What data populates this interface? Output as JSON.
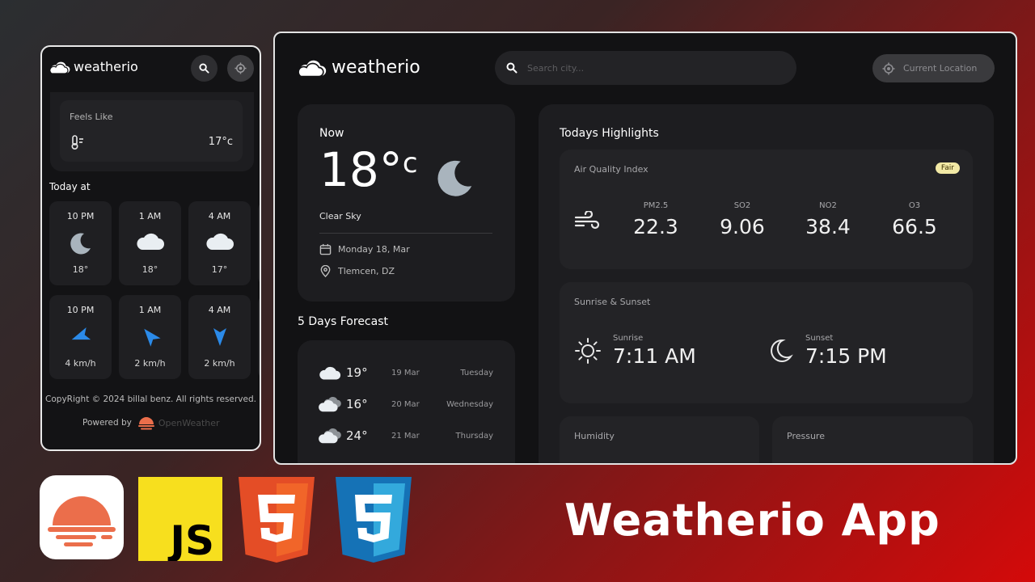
{
  "mobile": {
    "logo_text": "weatherio",
    "feels_like": {
      "label": "Feels Like",
      "value": "17°c"
    },
    "today_label": "Today at",
    "hourly_temp": [
      {
        "time": "10 PM",
        "icon": "moon-icon",
        "value": "18°"
      },
      {
        "time": "1 AM",
        "icon": "cloud-icon",
        "value": "18°"
      },
      {
        "time": "4 AM",
        "icon": "cloud-icon",
        "value": "17°"
      }
    ],
    "hourly_wind": [
      {
        "time": "10 PM",
        "icon": "wind-direction-icon",
        "value": "4 km/h"
      },
      {
        "time": "1 AM",
        "icon": "wind-direction-icon",
        "value": "2 km/h"
      },
      {
        "time": "4 AM",
        "icon": "wind-direction-icon",
        "value": "2 km/h"
      }
    ],
    "copyright": "CopyRight © 2024 billal benz. All rights reserved.",
    "powered_by": "Powered by",
    "powered_brand": "OpenWeather"
  },
  "desktop": {
    "logo_text": "weatherio",
    "search_placeholder": "Search city...",
    "current_location": "Current Location",
    "now": {
      "label": "Now",
      "temp": "18°",
      "temp_unit": "c",
      "condition": "Clear Sky",
      "date": "Monday 18, Mar",
      "location": "Tlemcen, DZ"
    },
    "forecast": {
      "title": "5 Days Forecast",
      "days": [
        {
          "temp": "19°",
          "date": "19 Mar",
          "day": "Tuesday",
          "icon": "cloud-icon"
        },
        {
          "temp": "16°",
          "date": "20 Mar",
          "day": "Wednesday",
          "icon": "cloud-icon"
        },
        {
          "temp": "24°",
          "date": "21 Mar",
          "day": "Thursday",
          "icon": "cloud-icon"
        }
      ]
    },
    "highlights": {
      "title": "Todays Highlights",
      "aqi": {
        "label": "Air Quality Index",
        "badge": "Fair",
        "items": [
          {
            "name": "PM2.5",
            "value": "22.3"
          },
          {
            "name": "SO2",
            "value": "9.06"
          },
          {
            "name": "NO2",
            "value": "38.4"
          },
          {
            "name": "O3",
            "value": "66.5"
          }
        ]
      },
      "sun": {
        "label": "Sunrise & Sunset",
        "sunrise_label": "Sunrise",
        "sunrise": "7:11 AM",
        "sunset_label": "Sunset",
        "sunset": "7:15 PM"
      },
      "humidity_label": "Humidity",
      "pressure_label": "Pressure"
    }
  },
  "footer_title": "Weatherio App",
  "tech_logos": [
    "openweather-logo",
    "javascript-logo",
    "html5-logo",
    "css3-logo"
  ],
  "colors": {
    "accent_red": "#d40a0a",
    "card_bg": "#1d1d20",
    "badge": "#f2e9a5",
    "wind_blue": "#2b8ae8"
  }
}
